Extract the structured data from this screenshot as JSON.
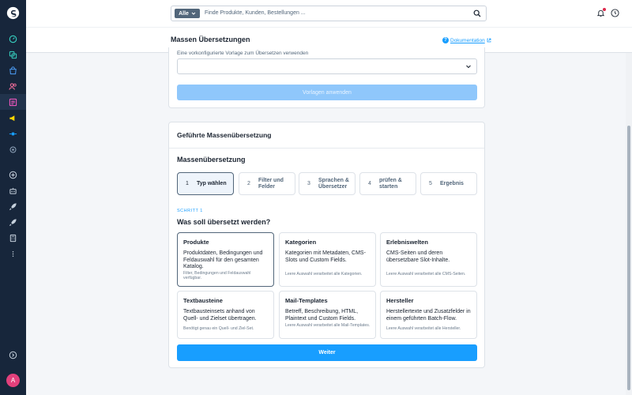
{
  "search": {
    "type_label": "Alle",
    "placeholder": "Finde Produkte, Kunden, Bestellungen ..."
  },
  "header": {
    "title": "Massen Übersetzungen",
    "doc_link": "Dokumentation"
  },
  "sidebar": {
    "avatar_initial": "A"
  },
  "template_card": {
    "label": "Eine vorkonfigurierte Vorlage zum Übersetzen verwenden",
    "apply_label": "Vorlagen anwenden"
  },
  "guided": {
    "title": "Geführte Massenübersetzung",
    "subtitle": "Massenübersetzung",
    "steps": [
      {
        "num": "1",
        "label": "Typ wählen"
      },
      {
        "num": "2",
        "label": "Filter und Felder"
      },
      {
        "num": "3",
        "label": "Sprachen & Übersetzer"
      },
      {
        "num": "4",
        "label": "prüfen & starten"
      },
      {
        "num": "5",
        "label": "Ergebnis"
      }
    ],
    "step_eyebrow": "SCHRITT 1",
    "question": "Was soll übersetzt werden?",
    "options": [
      {
        "title": "Produkte",
        "desc": "Produktdaten, Bedingungen und Feldauswahl für den gesamten Katalog.",
        "note": "Filter, Bedingungen und Feldauswahl verfügbar."
      },
      {
        "title": "Kategorien",
        "desc": "Kategorien mit Metadaten, CMS-Slots und Custom Fields.",
        "note": "Leere Auswahl verarbeitet alle Kategorien."
      },
      {
        "title": "Erlebniswelten",
        "desc": "CMS-Seiten und deren übersetzbare Slot-Inhalte.",
        "note": "Leere Auswahl verarbeitet alle CMS-Seiten."
      },
      {
        "title": "Textbausteine",
        "desc": "Textbausteinsets anhand von Quell- und Zielset übertragen.",
        "note": "Benötigt genau ein Quell- und Ziel-Set."
      },
      {
        "title": "Mail-Templates",
        "desc": "Betreff, Beschreibung, HTML, Plaintext und Custom Fields.",
        "note": "Leere Auswahl verarbeitet alle Mail-Templates."
      },
      {
        "title": "Hersteller",
        "desc": "Herstellertexte und Zusatzfelder in einem geführten Batch-Flow.",
        "note": "Leere Auswahl verarbeitet alle Hersteller."
      }
    ],
    "next_label": "Weiter"
  },
  "colors": {
    "sidebar": "#17263b",
    "accent": "#189eff",
    "avatar": "#e2407c"
  }
}
